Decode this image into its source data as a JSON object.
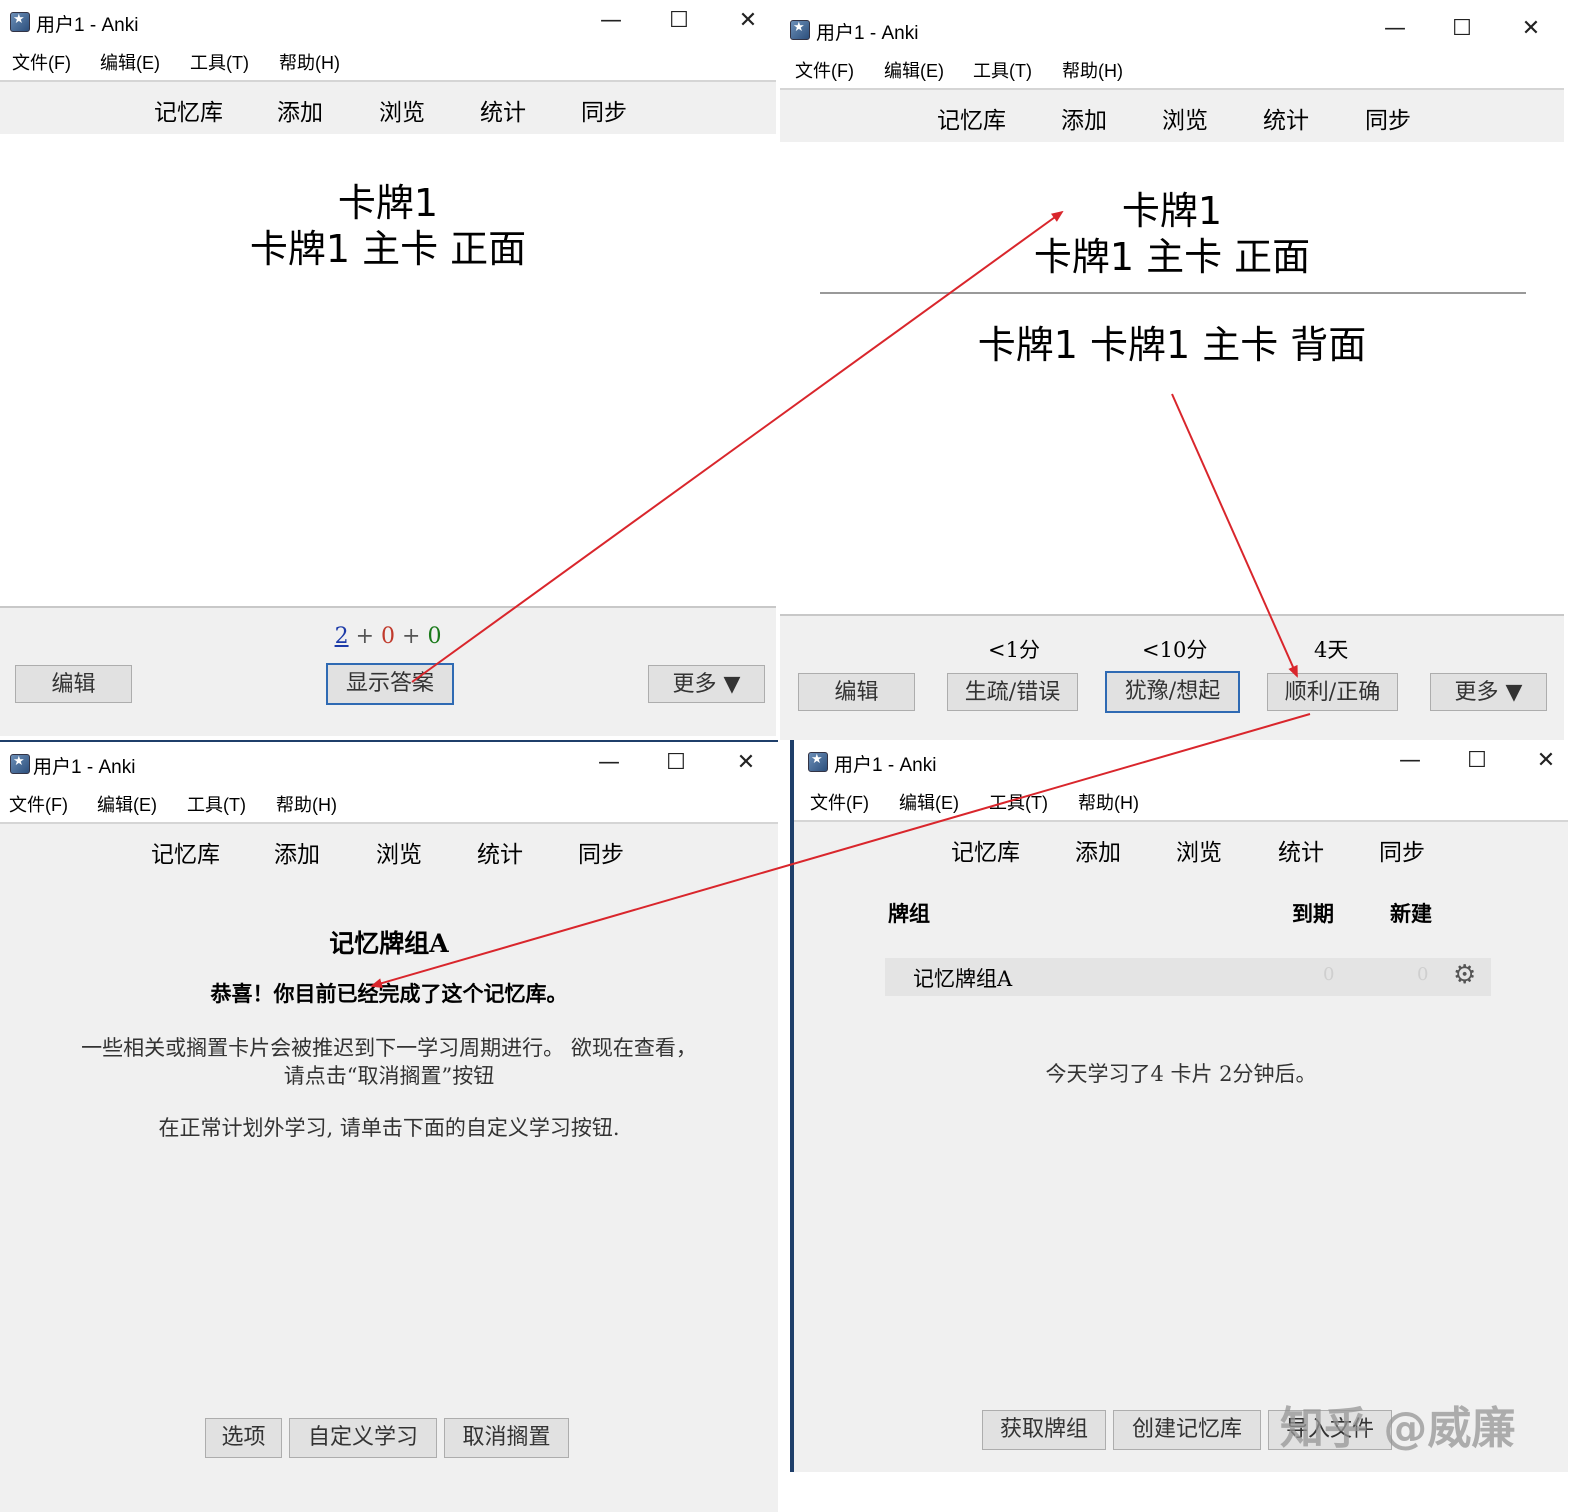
{
  "window_title": "用户1 - Anki",
  "menu": [
    "文件(F)",
    "编辑(E)",
    "工具(T)",
    "帮助(H)"
  ],
  "toolbar": [
    "记忆库",
    "添加",
    "浏览",
    "统计",
    "同步"
  ],
  "win_controls": {
    "minimize": "—",
    "maximize": "☐",
    "close": "✕"
  },
  "question_window": {
    "card_title": "卡牌1",
    "card_front": "卡牌1 主卡 正面",
    "counts": {
      "new": "2",
      "learn": "0",
      "review": "0",
      "plus": "+"
    },
    "edit_button": "编辑",
    "show_answer_button": "显示答案",
    "more_button": "更多 ▼"
  },
  "answer_window": {
    "card_title": "卡牌1",
    "card_front": "卡牌1 主卡 正面",
    "card_back": "卡牌1 卡牌1 主卡 背面",
    "edit_button": "编辑",
    "intervals": [
      "<1分",
      "<10分",
      "4天"
    ],
    "answers": [
      "生疏/错误",
      "犹豫/想起",
      "顺利/正确"
    ],
    "more_button": "更多 ▼"
  },
  "congrats_window": {
    "deck_title": "记忆牌组A",
    "congrats": "恭喜！你目前已经完成了这个记忆库。",
    "info_line1": "一些相关或搁置卡片会被推迟到下一学习周期进行。 欲现在查看，",
    "info_line2": "请点击“取消搁置”按钮",
    "custom_line": "在正常计划外学习, 请单击下面的自定义学习按钮.",
    "buttons": [
      "选项",
      "自定义学习",
      "取消搁置"
    ]
  },
  "deck_window": {
    "col_deck": "牌组",
    "col_due": "到期",
    "col_new": "新建",
    "deck_name": "记忆牌组A",
    "due": "0",
    "new": "0",
    "studied": "今天学习了4 卡片 2分钟后。",
    "buttons": [
      "获取牌组",
      "创建记忆库",
      "导入文件"
    ]
  },
  "watermark": "知乎 @威廉",
  "colors": {
    "arrow": "#d9262c",
    "new_count": "#1c3aa8",
    "learn_count": "#c0392b",
    "review_count": "#1a7a1a",
    "focus_border": "#2f6ab3"
  }
}
